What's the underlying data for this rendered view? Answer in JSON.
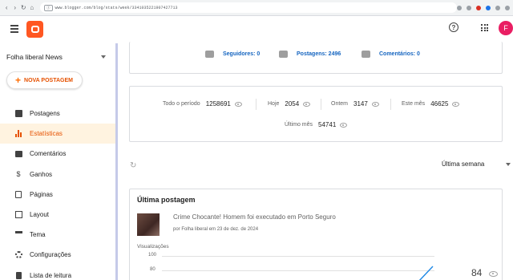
{
  "browser": {
    "url_tag": "Ⓘ",
    "url": "www.blogger.com/blog/stats/week/3341035221907427713"
  },
  "header": {
    "help_label": "?",
    "avatar_initial": "F"
  },
  "sidebar": {
    "blog_name": "Folha liberal News",
    "new_post_label": "NOVA POSTAGEM",
    "items": [
      {
        "label": "Postagens",
        "icon": "posts-icon"
      },
      {
        "label": "Estatísticas",
        "icon": "stats-icon",
        "active": true
      },
      {
        "label": "Comentários",
        "icon": "comments-icon"
      },
      {
        "label": "Ganhos",
        "icon": "dollar-icon"
      },
      {
        "label": "Páginas",
        "icon": "pages-icon"
      },
      {
        "label": "Layout",
        "icon": "layout-icon"
      },
      {
        "label": "Tema",
        "icon": "theme-icon"
      },
      {
        "label": "Configurações",
        "icon": "gear-icon"
      },
      {
        "label": "Lista de leitura",
        "icon": "reading-list-icon"
      }
    ]
  },
  "summary": {
    "followers": "Seguidores: 0",
    "posts": "Postagens: 2496",
    "comments": "Comentários: 0"
  },
  "periods": [
    {
      "label": "Todo o período",
      "value": "1258691"
    },
    {
      "label": "Hoje",
      "value": "2054"
    },
    {
      "label": "Ontem",
      "value": "3147"
    },
    {
      "label": "Este mês",
      "value": "46625"
    },
    {
      "label": "Último mês",
      "value": "54741"
    }
  ],
  "range": {
    "selected": "Última semana"
  },
  "latest_post": {
    "section_title": "Última postagem",
    "title": "Crime Chocante! Homem foi executado em Porto Seguro",
    "meta": "por Folha liberal em 23 de dez. de 2024",
    "views_total": "84"
  },
  "chart_data": {
    "type": "line",
    "ylabel": "Visualizações",
    "y_ticks": [
      "100",
      "80"
    ],
    "series": [
      {
        "values": [
          84
        ]
      }
    ]
  },
  "colors": {
    "accent": "#e65100",
    "link": "#1565c0",
    "logo": "#ff5722",
    "avatar": "#e91e63"
  }
}
